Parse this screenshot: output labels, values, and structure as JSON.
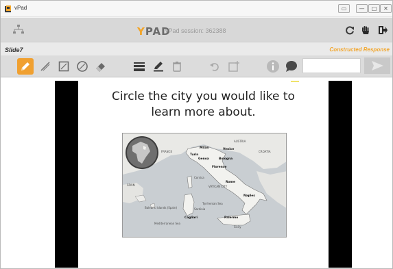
{
  "window": {
    "title": "vPad",
    "controls": [
      "restore",
      "minimize",
      "maximize",
      "close"
    ]
  },
  "header": {
    "logo_accent": "Y",
    "logo_rest": "PAD",
    "session": "vPad session: 362388",
    "buttons": [
      "refresh-icon",
      "hand-icon",
      "exit-icon"
    ]
  },
  "slidebar": {
    "slide_name": "Slide7",
    "response_type": "Constructed Response"
  },
  "toolbar": {
    "tools": [
      "pencil-icon",
      "line-icon",
      "rectangle-icon",
      "circle-icon",
      "eraser-icon",
      "line-weight-icon",
      "color-pen-icon",
      "trash-icon",
      "undo-icon",
      "new-slide-icon",
      "info-icon",
      "chat-icon"
    ],
    "active_tool": "pencil-icon",
    "chat_placeholder": "",
    "send_icon": "send-icon"
  },
  "slide": {
    "title_line1": "Circle the city you would like to",
    "title_line2": "learn more about."
  },
  "map": {
    "regions": [
      "FRANCE",
      "AUSTRIA",
      "CROATIA",
      "SPAIN",
      "VATICAN CITY",
      "Balearic Islands (Spain)",
      "Mediterranean Sea",
      "Tyrrhenian Sea",
      "Sicily",
      "Sardinia",
      "Corsica"
    ],
    "cities": [
      "Milan",
      "Turin",
      "Venice",
      "Genoa",
      "Bologna",
      "Florence",
      "Rome",
      "Naples",
      "Palermo",
      "Cagliari"
    ]
  },
  "colors": {
    "accent": "#f2a52a",
    "active_tool": "#f0a030",
    "toolbar": "#dcdcdc",
    "header": "#d8d8d8"
  }
}
